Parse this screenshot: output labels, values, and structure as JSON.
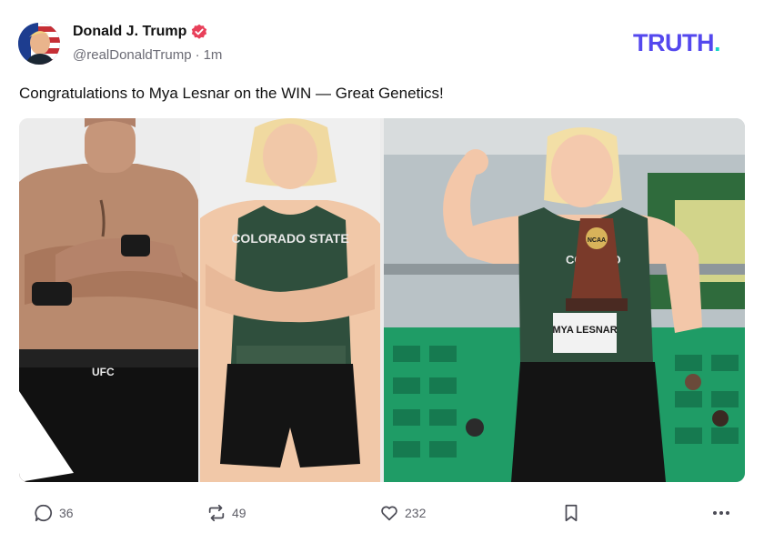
{
  "author": {
    "display_name": "Donald J. Trump",
    "handle": "@realDonaldTrump",
    "separator": "·",
    "time_ago": "1m",
    "verified": true
  },
  "brand": {
    "logo_text": "TRUTH.",
    "color": "#5448ee",
    "accent": "#17d6c6"
  },
  "post": {
    "text": "Congratulations to Mya Lesnar on the WIN — Great Genetics!",
    "images": [
      {
        "description": "man with arms crossed",
        "logo_text": "UFC"
      },
      {
        "description": "athlete in jersey, arms crossed",
        "jersey_text": "COLORADO STATE"
      },
      {
        "description": "athlete flexing with trophy",
        "bib_text": "MYA LESNAR",
        "trophy_text": "NCAA"
      }
    ]
  },
  "actions": {
    "reply": {
      "icon": "comment-icon",
      "count": "36"
    },
    "retruth": {
      "icon": "retruth-icon",
      "count": "49"
    },
    "like": {
      "icon": "heart-icon",
      "count": "232"
    },
    "save": {
      "icon": "bookmark-icon"
    },
    "more": {
      "icon": "more-icon"
    }
  },
  "colors": {
    "verified": "#e8405a",
    "jersey_green": "#2f4f3d",
    "stadium_seat": "#1f9c66"
  }
}
